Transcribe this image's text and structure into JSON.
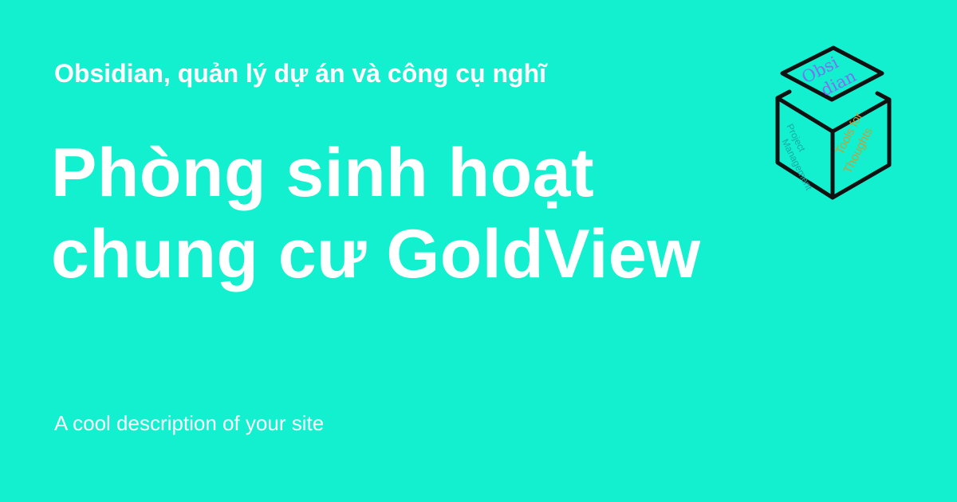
{
  "site": {
    "name": "Obsidian, quản lý dự án và công cụ nghĩ",
    "description": "A cool description of your site"
  },
  "page": {
    "title": "Phòng sinh hoạt chung cư GoldView"
  },
  "logo": {
    "icon": "obsidian-cube-icon",
    "lid_line_1": "Obsi",
    "lid_line_2": "dian",
    "left_face_line_1": "Project",
    "left_face_line_2": "Management",
    "right_face_line_1": "Tools for",
    "right_face_line_2": "Thoughts"
  },
  "colors": {
    "background": "#12f0cf",
    "text": "#ffffff",
    "lid_text": "#7f6df2",
    "left_face_text": "#1aa9a1",
    "right_face_text": "#c79d3a",
    "cube_outline": "#111111"
  }
}
